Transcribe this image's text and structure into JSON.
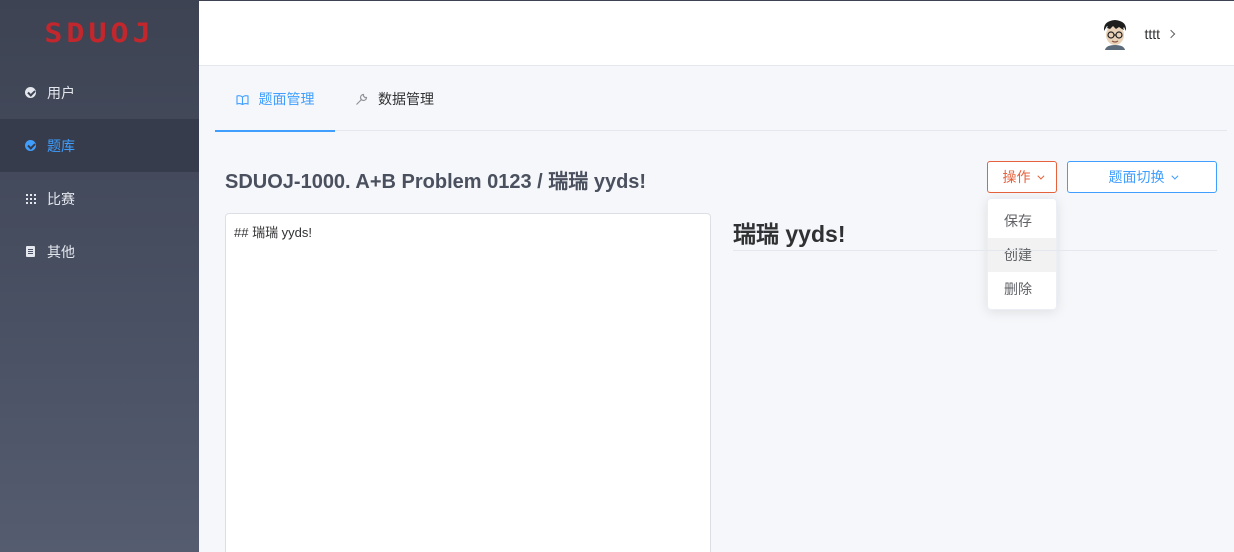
{
  "sidebar": {
    "logo": "SDUOJ",
    "items": [
      {
        "label": "用户",
        "icon": "check-circle-icon"
      },
      {
        "label": "题库",
        "icon": "check-circle-icon"
      },
      {
        "label": "比赛",
        "icon": "grid-icon"
      },
      {
        "label": "其他",
        "icon": "document-icon"
      }
    ]
  },
  "header": {
    "username": "tttt"
  },
  "tabs": [
    {
      "label": "题面管理",
      "icon": "book-icon"
    },
    {
      "label": "数据管理",
      "icon": "wrench-icon"
    }
  ],
  "problem": {
    "title": "SDUOJ-1000. A+B Problem 0123 / 瑞瑞 yyds!"
  },
  "actions": {
    "ops_label": "操作",
    "switch_label": "题面切换",
    "dropdown": [
      "保存",
      "创建",
      "删除"
    ]
  },
  "editor": {
    "content": "## 瑞瑞 yyds!"
  },
  "preview": {
    "heading": "瑞瑞 yyds!"
  },
  "colors": {
    "accent": "#409eff",
    "danger": "#e6623d",
    "sidebar": "#3d4352",
    "logo": "#c1272d"
  }
}
